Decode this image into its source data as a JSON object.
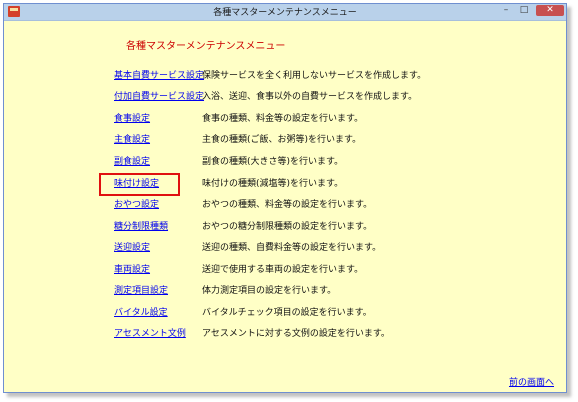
{
  "window": {
    "title": "各種マスターメンテナンスメニュー",
    "min_glyph": "–",
    "max_glyph": "□",
    "close_glyph": "✕"
  },
  "page": {
    "heading": "各種マスターメンテナンスメニュー"
  },
  "menu": [
    {
      "label": "基本自費サービス設定",
      "desc": "保険サービスを全く利用しないサービスを作成します。"
    },
    {
      "label": "付加自費サービス設定",
      "desc": "入浴、送迎、食事以外の自費サービスを作成します。"
    },
    {
      "label": "食事設定",
      "desc": "食事の種類、料金等の設定を行います。"
    },
    {
      "label": "主食設定",
      "desc": "主食の種類(ご飯、お粥等)を行います。"
    },
    {
      "label": "副食設定",
      "desc": "副食の種類(大きさ等)を行います。"
    },
    {
      "label": "味付け設定",
      "desc": "味付けの種類(減塩等)を行います。"
    },
    {
      "label": "おやつ設定",
      "desc": "おやつの種類、料金等の設定を行います。"
    },
    {
      "label": "糖分制限種類",
      "desc": "おやつの糖分制限種類の設定を行います。"
    },
    {
      "label": "送迎設定",
      "desc": "送迎の種類、自費料金等の設定を行います。"
    },
    {
      "label": "車両設定",
      "desc": "送迎で使用する車両の設定を行います。"
    },
    {
      "label": "測定項目設定",
      "desc": "体力測定項目の設定を行います。"
    },
    {
      "label": "バイタル設定",
      "desc": "バイタルチェック項目の設定を行います。"
    },
    {
      "label": "アセスメント文例",
      "desc": "アセスメントに対する文例の設定を行います。"
    }
  ],
  "footer": {
    "back_label": "前の画面へ"
  }
}
